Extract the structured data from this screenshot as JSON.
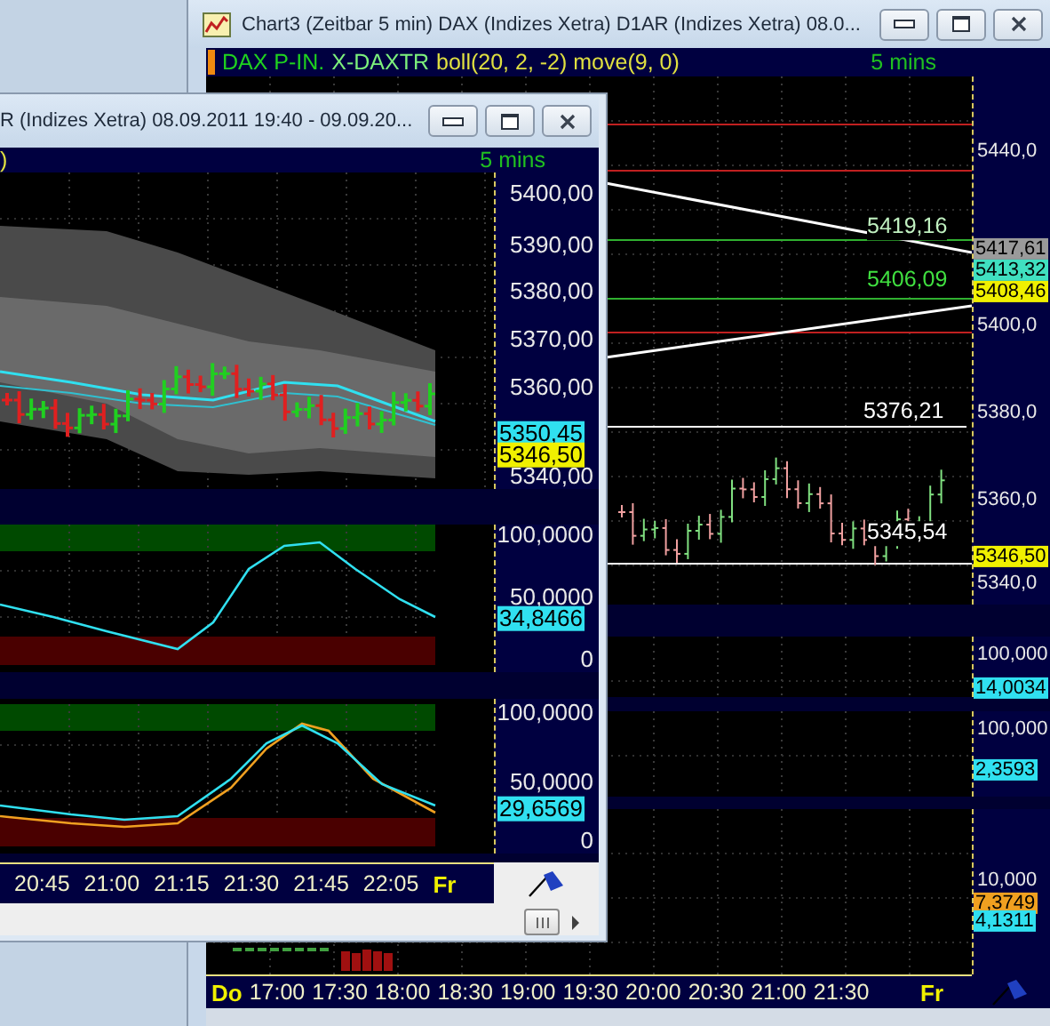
{
  "back_window": {
    "title": "Chart3 (Zeitbar 5 min)  DAX (Indizes Xetra) D1AR (Indizes Xetra) 08.0...",
    "legend": [
      {
        "text": "DAX P-IN.",
        "color": "#1fd21f"
      },
      {
        "text": "X-DAXTR",
        "color": "#7cf07c"
      },
      {
        "text": "boll(20, 2, -2) move(9, 0)",
        "color": "#e0e040"
      }
    ],
    "interval": "5 mins",
    "panels": [
      {
        "ticks": [
          "5440,0",
          "5400,0",
          "5380,0",
          "5360,0",
          "5340,0"
        ],
        "tags": [
          {
            "text": "5417,61",
            "color": "#9a9a9a"
          },
          {
            "text": "5413,32",
            "color": "#40e0c0"
          },
          {
            "text": "5408,46",
            "color": "#f0f000"
          },
          {
            "text": "5346,50",
            "color": "#f0f000"
          }
        ],
        "line_labels": [
          {
            "text": "5419,16",
            "color": "#c0f0c0"
          },
          {
            "text": "5406,09",
            "color": "#40e040"
          },
          {
            "text": "5376,21",
            "color": "#ffffff"
          },
          {
            "text": "5345,54",
            "color": "#ffffff"
          }
        ]
      },
      {
        "ticks": [
          "100,000"
        ],
        "tags": [
          {
            "text": "14,0034",
            "color": "#30e0f0"
          }
        ]
      },
      {
        "ticks": [
          "100,000"
        ],
        "tags": [
          {
            "text": "2,3593",
            "color": "#30e0f0"
          }
        ]
      },
      {
        "ticks": [
          "10,000"
        ],
        "tags": [
          {
            "text": "7,3749",
            "color": "#f0a020"
          },
          {
            "text": "4,1311",
            "color": "#30e0f0"
          }
        ]
      }
    ],
    "time_axis": {
      "start_day": "Do",
      "times": [
        "17:00",
        "17:30",
        "18:00",
        "18:30",
        "19:00",
        "19:30",
        "20:00",
        "20:30",
        "21:00",
        "21:30"
      ],
      "end_day": "Fr"
    }
  },
  "front_window": {
    "title": "R (Indizes Xetra) 08.09.2011 19:40 - 09.09.20...",
    "legend_tail": ")",
    "interval": "5 mins",
    "panels": [
      {
        "ticks": [
          "5400,00",
          "5390,00",
          "5380,00",
          "5370,00",
          "5360,00",
          "5340,00"
        ],
        "tags": [
          {
            "text": "5350,45",
            "color": "#30e0f0"
          },
          {
            "text": "5346,50",
            "color": "#f0f000"
          }
        ]
      },
      {
        "ticks": [
          "100,0000",
          "50,0000",
          "0"
        ],
        "tags": [
          {
            "text": "34,8466",
            "color": "#30e0f0"
          }
        ]
      },
      {
        "ticks": [
          "100,0000",
          "50,0000",
          "0"
        ],
        "tags": [
          {
            "text": "29,6569",
            "color": "#30e0f0"
          }
        ]
      }
    ],
    "time_axis": {
      "times": [
        "20:45",
        "21:00",
        "21:15",
        "21:30",
        "21:45",
        "22:05"
      ],
      "end_day": "Fr"
    }
  }
}
